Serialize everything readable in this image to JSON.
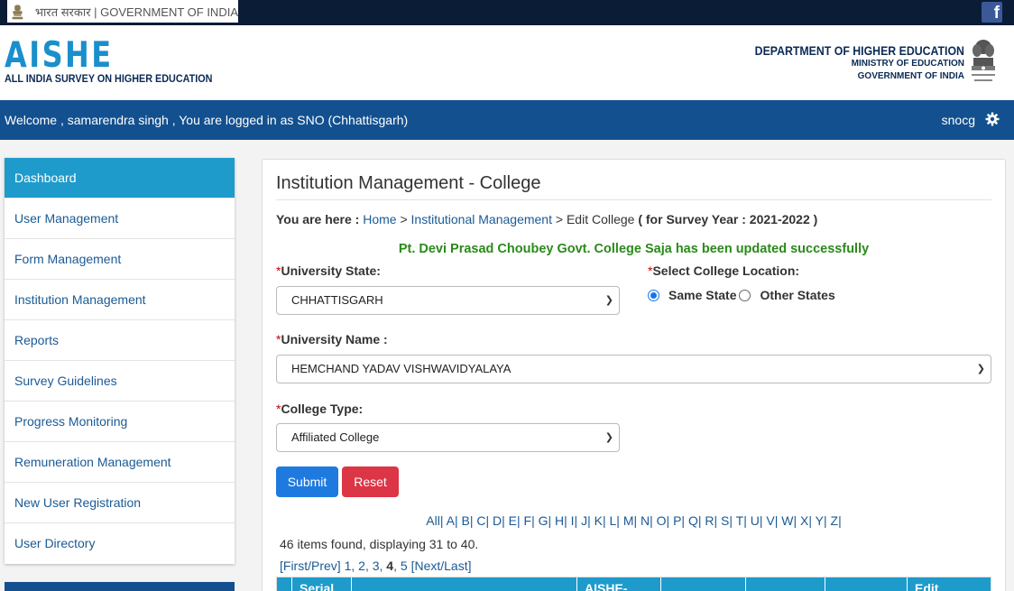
{
  "gov_bar": {
    "text": "भारत सरकार | GOVERNMENT OF INDIA",
    "fb_letter": "f"
  },
  "header": {
    "logo": "AISHE",
    "logo_sub": "ALL INDIA SURVEY ON HIGHER EDUCATION",
    "dept_line1": "DEPARTMENT OF HIGHER EDUCATION",
    "dept_line2": "MINISTRY OF EDUCATION",
    "dept_line3": "GOVERNMENT OF INDIA"
  },
  "welcome": {
    "text": "Welcome , samarendra singh , You are logged in as SNO (Chhattisgarh)",
    "user": "snocg"
  },
  "sidebar": {
    "items": [
      {
        "label": "Dashboard"
      },
      {
        "label": "User Management"
      },
      {
        "label": "Form Management"
      },
      {
        "label": "Institution Management"
      },
      {
        "label": "Reports"
      },
      {
        "label": "Survey Guidelines"
      },
      {
        "label": "Progress Monitoring"
      },
      {
        "label": "Remuneration Management"
      },
      {
        "label": "New User Registration"
      },
      {
        "label": "User Directory"
      }
    ]
  },
  "main": {
    "title": "Institution Management - College",
    "breadcrumb": {
      "prefix": "You are here :",
      "home": "Home",
      "sep": ">",
      "section": "Institutional Management",
      "page": "Edit College",
      "year": "( for Survey Year : 2021-2022 )"
    },
    "success_message": "Pt. Devi Prasad Choubey Govt. College Saja has been updated successfully",
    "form": {
      "required_mark": "*",
      "university_state_label": "University State:",
      "university_state_value": "CHHATTISGARH",
      "college_location_label": "Select College Location:",
      "same_state": "Same State",
      "other_states": "Other States",
      "university_name_label": "University Name :",
      "university_name_value": "HEMCHAND YADAV VISHWAVIDYALAYA",
      "college_type_label": "College Type:",
      "college_type_value": "Affiliated College",
      "submit": "Submit",
      "reset": "Reset"
    },
    "alpha_filter": [
      "All|",
      "A|",
      "B|",
      "C|",
      "D|",
      "E|",
      "F|",
      "G|",
      "H|",
      "I|",
      "J|",
      "K|",
      "L|",
      "M|",
      "N|",
      "O|",
      "P|",
      "Q|",
      "R|",
      "S|",
      "T|",
      "U|",
      "V|",
      "W|",
      "X|",
      "Y|",
      "Z|"
    ],
    "count_text": "46 items found, displaying 31 to 40.",
    "pager": {
      "first_prev": "[First/Prev]",
      "p1": "1",
      "p2": "2",
      "p3": "3",
      "p4": "4",
      "p5": "5",
      "next_last": "[Next/Last]"
    },
    "table_headers": {
      "serial": "Serial.",
      "aishe": "AISHE-",
      "edit": "Edit"
    }
  }
}
